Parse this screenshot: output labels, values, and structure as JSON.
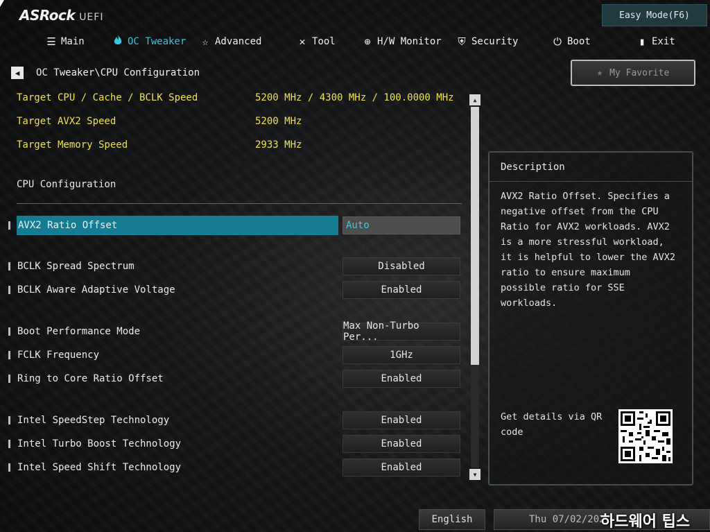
{
  "header": {
    "logo": "ASRock",
    "logo_sub": "UEFI",
    "easy_mode": "Easy Mode(F6)"
  },
  "tabs": [
    {
      "label": "Main",
      "icon": "list-icon"
    },
    {
      "label": "OC Tweaker",
      "icon": "flame-icon",
      "active": true
    },
    {
      "label": "Advanced",
      "icon": "star-icon"
    },
    {
      "label": "Tool",
      "icon": "tools-icon"
    },
    {
      "label": "H/W Monitor",
      "icon": "monitor-icon"
    },
    {
      "label": "Security",
      "icon": "shield-icon"
    },
    {
      "label": "Boot",
      "icon": "power-icon"
    },
    {
      "label": "Exit",
      "icon": "exit-icon"
    }
  ],
  "breadcrumb": "OC Tweaker\\CPU Configuration",
  "favorite": "My Favorite",
  "info": [
    {
      "label": "Target CPU / Cache / BCLK Speed",
      "value": "5200 MHz / 4300 MHz / 100.0000 MHz"
    },
    {
      "label": "Target AVX2 Speed",
      "value": "5200 MHz"
    },
    {
      "label": "Target Memory Speed",
      "value": "2933 MHz"
    }
  ],
  "section_title": "CPU Configuration",
  "options": [
    {
      "label": "AVX2 Ratio Offset",
      "value": "Auto",
      "selected": true
    },
    {
      "label": "BCLK Spread Spectrum",
      "value": "Disabled"
    },
    {
      "label": "BCLK Aware Adaptive Voltage",
      "value": "Enabled"
    },
    {
      "label": "Boot Performance Mode",
      "value": "Max Non-Turbo Per..."
    },
    {
      "label": "FCLK Frequency",
      "value": "1GHz"
    },
    {
      "label": "Ring to Core Ratio Offset",
      "value": "Enabled"
    },
    {
      "label": "Intel SpeedStep Technology",
      "value": "Enabled"
    },
    {
      "label": "Intel Turbo Boost Technology",
      "value": "Enabled"
    },
    {
      "label": "Intel Speed Shift Technology",
      "value": "Enabled"
    }
  ],
  "description": {
    "title": "Description",
    "text": "AVX2 Ratio Offset. Specifies a\nnegative offset from the CPU\nRatio for AVX2 workloads. AVX2\nis a more stressful workload,\nit is helpful to lower the AVX2\nratio to ensure maximum\npossible ratio for SSE\nworkloads.",
    "qr_label": "Get details via QR code"
  },
  "footer": {
    "language": "English",
    "datetime": "Thu 07/02/202"
  },
  "watermark": "하드웨어 팁스",
  "colors": {
    "accent": "#39c6e0",
    "highlight": "#167c93",
    "info_yellow": "#f0e34a"
  }
}
